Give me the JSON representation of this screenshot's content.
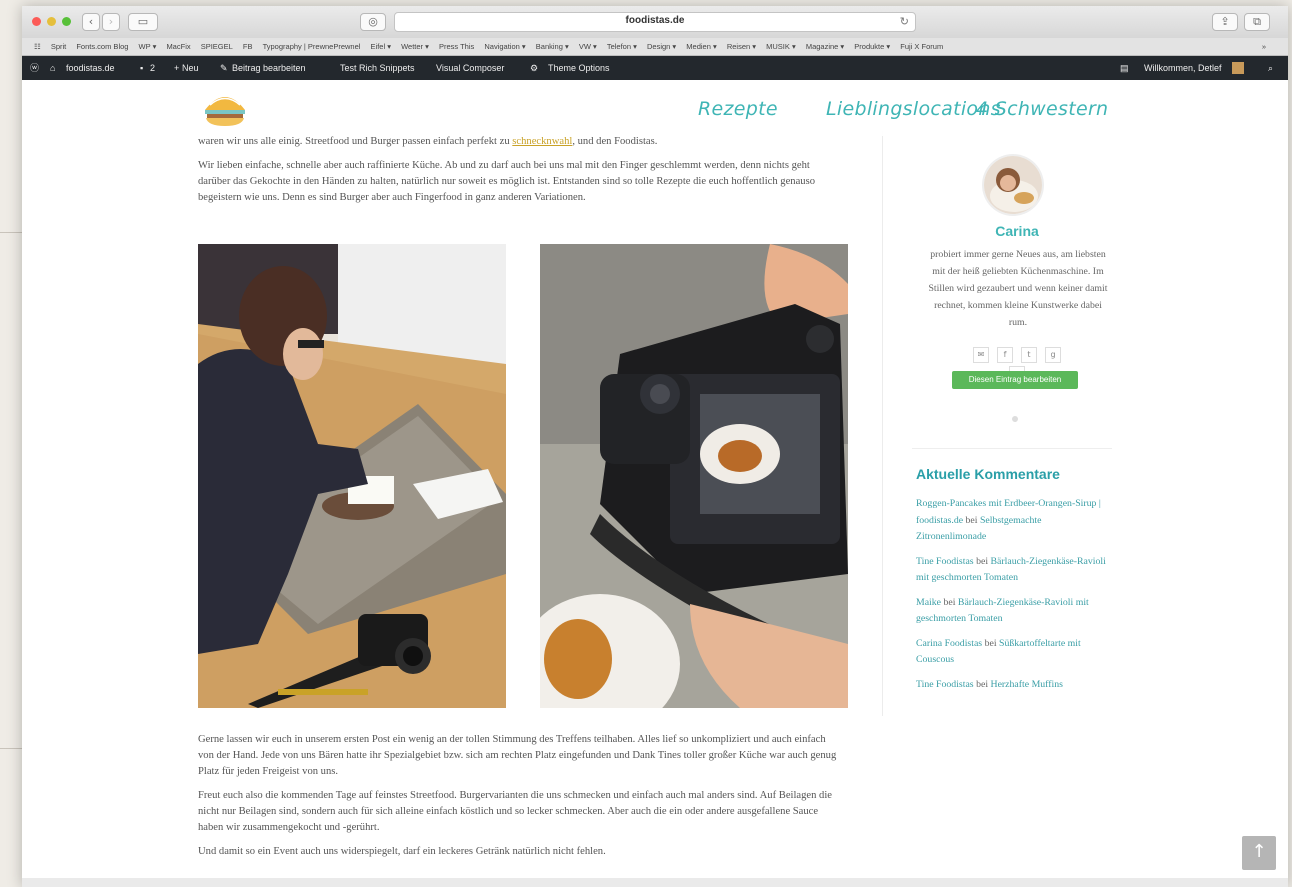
{
  "browser": {
    "url": "foodistas.de",
    "bookmarks": [
      "Sprit",
      "Fonts.com Blog",
      "WP ▾",
      "MacFix",
      "SPIEGEL",
      "FB",
      "Typography | PrewnePrewnel",
      "Eifel ▾",
      "Wetter ▾",
      "Press This",
      "Navigation ▾",
      "Banking ▾",
      "VW ▾",
      "Telefon ▾",
      "Design ▾",
      "Medien ▾",
      "Reisen ▾",
      "MUSIK ▾",
      "Magazine ▾",
      "Produkte ▾",
      "Fuji X Forum"
    ],
    "more": "»"
  },
  "adminbar": {
    "site": "foodistas.de",
    "comments": "2",
    "new": "Neu",
    "edit": "Beitrag bearbeiten",
    "rich": "Test Rich Snippets",
    "composer": "Visual Composer",
    "theme": "Theme Options",
    "welcome": "Willkommen, Detlef"
  },
  "nav": {
    "items": [
      "Rezepte",
      "Lieblingslocations",
      "4 Schwestern"
    ]
  },
  "article": {
    "p0": "waren wir uns alle einig. Streetfood und Burger passen einfach perfekt zu",
    "p0_link": "schnecknwahl",
    "p0_end": ", und den Foodistas.",
    "p1": "Wir lieben einfache, schnelle aber auch raffinierte Küche. Ab und zu darf auch bei uns mal mit den Finger geschlemmt werden, denn nichts geht darüber das Gekochte in den Händen zu halten, natürlich nur soweit es möglich ist. Entstanden sind so tolle Rezepte die euch hoffentlich genauso begeistern wie uns. Denn es sind Burger aber auch Fingerfood in ganz anderen Variationen.",
    "p2": "Gerne lassen wir euch in unserem ersten Post ein wenig an der tollen Stimmung des Treffens teilhaben. Alles lief so unkompliziert und auch einfach von der Hand. Jede von uns Bären hatte ihr Spezialgebiet bzw. sich am rechten Platz eingefunden und Dank Tines toller großer Küche war auch genug Platz für jeden Freigeist von uns.",
    "p3": "Freut euch also die kommenden Tage auf feinstes Streetfood. Burgervarianten die uns schmecken und einfach auch mal anders sind. Auf Beilagen die nicht nur Beilagen sind, sondern auch für sich alleine einfach köstlich und so lecker schmecken. Aber auch die ein oder andere ausgefallene Sauce haben wir zusammengekocht und -gerührt.",
    "p4": "Und damit so ein Event auch uns widerspiegelt, darf ein leckeres Getränk natürlich nicht fehlen."
  },
  "sidebar": {
    "author": "Carina",
    "bio": "probiert immer gerne Neues aus, am liebsten mit der heiß geliebten Küchenmaschine. Im Stillen wird gezaubert und wenn keiner damit rechnet, kommen kleine Kunstwerke dabei rum.",
    "edit_button": "Diesen Eintrag bearbeiten",
    "widget_title": "Aktuelle Kommentare",
    "comments": [
      {
        "author": "Roggen-Pancakes mit Erdbeer-Orangen-Sirup | foodistas.de",
        "bei": "bei",
        "post": "Selbstgemachte Zitronenlimonade"
      },
      {
        "author": "Tine Foodistas",
        "bei": "bei",
        "post": "Bärlauch-Ziegenkäse-Ravioli mit geschmorten Tomaten"
      },
      {
        "author": "Maike",
        "bei": "bei",
        "post": "Bärlauch-Ziegenkäse-Ravioli mit geschmorten Tomaten"
      },
      {
        "author": "Carina Foodistas",
        "bei": "bei",
        "post": "Süßkartoffeltarte mit Couscous"
      },
      {
        "author": "Tine Foodistas",
        "bei": "bei",
        "post": "Herzhafte Muffins"
      }
    ]
  },
  "colors": {
    "accent": "#3fb5b5",
    "adminbar": "#23282d",
    "edit_button": "#5bb85a"
  }
}
